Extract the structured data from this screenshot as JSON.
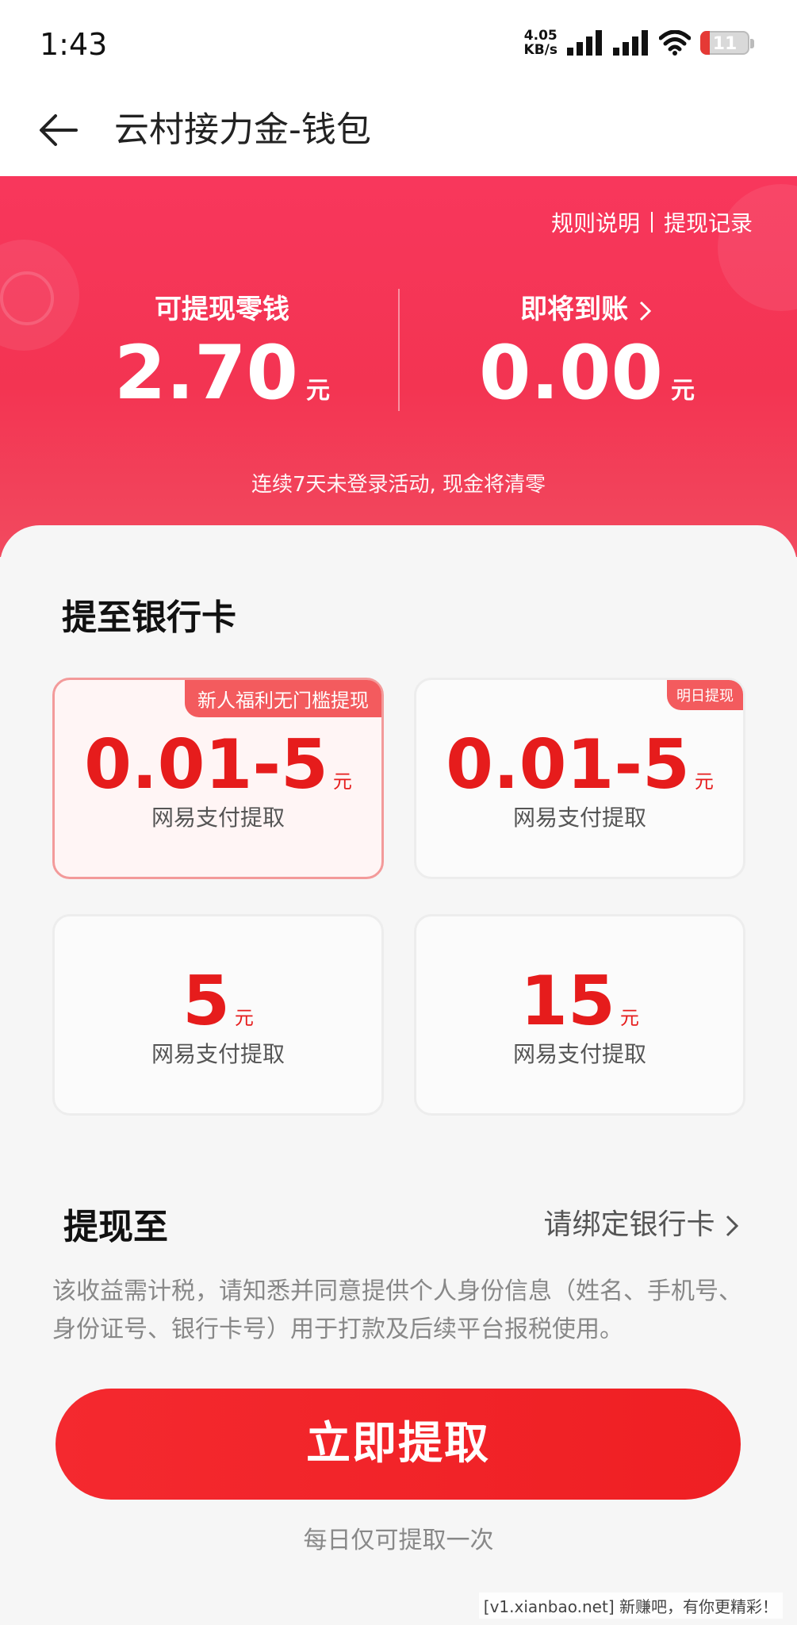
{
  "status_bar": {
    "time": "1:43",
    "speed_value": "4.05",
    "speed_unit": "KB/s",
    "battery_level": "11",
    "icons": [
      "signal-icon",
      "signal-icon",
      "wifi-icon",
      "battery-icon"
    ]
  },
  "nav": {
    "back_icon": "back-arrow-icon",
    "title": "云村接力金-钱包"
  },
  "header": {
    "rules_link": "规则说明",
    "records_link": "提现记录",
    "withdrawable": {
      "label": "可提现零钱",
      "amount": "2.70",
      "unit": "元"
    },
    "pending": {
      "label": "即将到账",
      "amount": "0.00",
      "unit": "元"
    },
    "warning": "连续7天未登录活动, 现金将清零",
    "colors": {
      "primary_red": "#f33452",
      "text": "#ffffff"
    }
  },
  "bank": {
    "title": "提至银行卡",
    "options": [
      {
        "tag": "新人福利无门槛提现",
        "amount": "0.01-5",
        "unit": "元",
        "method": "网易支付提取",
        "selected": true
      },
      {
        "tag": "明日提现",
        "amount": "0.01-5",
        "unit": "元",
        "method": "网易支付提取",
        "selected": false
      },
      {
        "tag": "",
        "amount": "5",
        "unit": "元",
        "method": "网易支付提取",
        "selected": false
      },
      {
        "tag": "",
        "amount": "15",
        "unit": "元",
        "method": "网易支付提取",
        "selected": false
      }
    ],
    "colors": {
      "amount_red": "#e61c1c",
      "tag_red": "#f35b5e"
    }
  },
  "withdraw_to": {
    "label": "提现至",
    "bind_card": "请绑定银行卡"
  },
  "tax_note": "该收益需计税，请知悉并同意提供个人身份信息（姓名、手机号、身份证号、银行卡号）用于打款及后续平台报税使用。",
  "submit": {
    "label": "立即提取",
    "color": "#f4292f"
  },
  "daily_limit": "每日仅可提取一次",
  "watermark": "[v1.xianbao.net] 新赚吧，有你更精彩！"
}
